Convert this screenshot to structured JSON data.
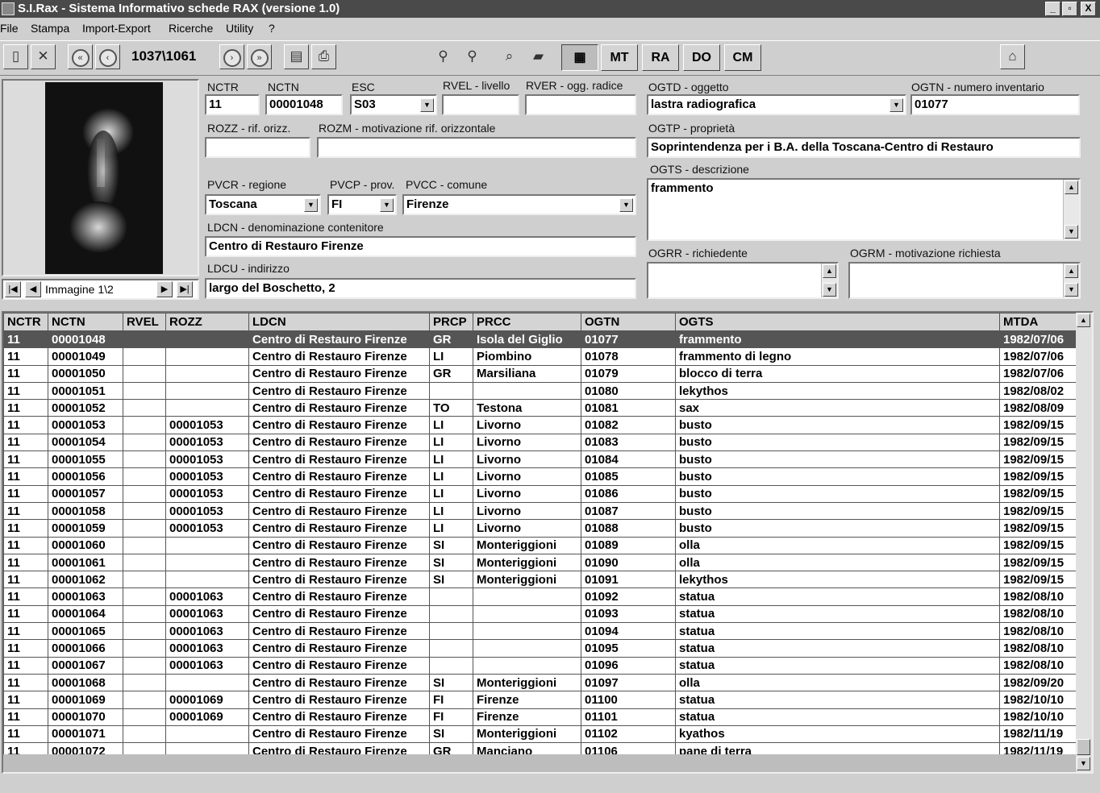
{
  "window": {
    "title": "S.I.Rax - Sistema Informativo schede RAX (versione 1.0)",
    "min": "_",
    "max": "▫",
    "close": "X"
  },
  "menu": [
    "File",
    "Stampa",
    "Import-Export",
    "Ricerche",
    "Utility",
    "?"
  ],
  "toolbar": {
    "counter": "1037\\1061",
    "mt": "MT",
    "ra": "RA",
    "do": "DO",
    "cm": "CM"
  },
  "fields": {
    "nctr": {
      "label": "NCTR",
      "value": "11"
    },
    "nctn": {
      "label": "NCTN",
      "value": "00001048"
    },
    "esc": {
      "label": "ESC",
      "value": "S03"
    },
    "rvel": {
      "label": "RVEL - livello",
      "value": ""
    },
    "rver": {
      "label": "RVER - ogg. radice",
      "value": ""
    },
    "ogtd": {
      "label": "OGTD - oggetto",
      "value": "lastra radiografica"
    },
    "ogtn": {
      "label": "OGTN - numero inventario",
      "value": "01077"
    },
    "rozz": {
      "label": "ROZZ - rif. orizz.",
      "value": ""
    },
    "rozm": {
      "label": "ROZM - motivazione rif. orizzontale",
      "value": ""
    },
    "ogtp": {
      "label": "OGTP - proprietà",
      "value": "Soprintendenza per i B.A. della Toscana-Centro di Restauro"
    },
    "ogts": {
      "label": "OGTS - descrizione",
      "value": "frammento"
    },
    "pvcr": {
      "label": "PVCR - regione",
      "value": "Toscana"
    },
    "pvcp": {
      "label": "PVCP - prov.",
      "value": "FI"
    },
    "pvcc": {
      "label": "PVCC - comune",
      "value": "Firenze"
    },
    "ldcn": {
      "label": "LDCN - denominazione contenitore",
      "value": "Centro di Restauro Firenze"
    },
    "ldcu": {
      "label": "LDCU - indirizzo",
      "value": "largo del Boschetto, 2"
    },
    "ogrr": {
      "label": "OGRR - richiedente",
      "value": ""
    },
    "ogrm": {
      "label": "OGRM - motivazione richiesta",
      "value": ""
    }
  },
  "image_nav": {
    "label": "Immagine 1\\2"
  },
  "table": {
    "columns": [
      "NCTR",
      "NCTN",
      "RVEL",
      "ROZZ",
      "LDCN",
      "PRCP",
      "PRCC",
      "OGTN",
      "OGTS",
      "MTDA"
    ],
    "rows": [
      [
        "11",
        "00001048",
        "",
        "",
        "Centro di Restauro Firenze",
        "GR",
        "Isola del Giglio",
        "01077",
        "frammento",
        "1982/07/06"
      ],
      [
        "11",
        "00001049",
        "",
        "",
        "Centro di Restauro Firenze",
        "LI",
        "Piombino",
        "01078",
        "frammento di legno",
        "1982/07/06"
      ],
      [
        "11",
        "00001050",
        "",
        "",
        "Centro di Restauro Firenze",
        "GR",
        "Marsiliana",
        "01079",
        "blocco di terra",
        "1982/07/06"
      ],
      [
        "11",
        "00001051",
        "",
        "",
        "Centro di Restauro Firenze",
        "",
        "",
        "01080",
        "lekythos",
        "1982/08/02"
      ],
      [
        "11",
        "00001052",
        "",
        "",
        "Centro di Restauro Firenze",
        "TO",
        "Testona",
        "01081",
        "sax",
        "1982/08/09"
      ],
      [
        "11",
        "00001053",
        "",
        "00001053",
        "Centro di Restauro Firenze",
        "LI",
        "Livorno",
        "01082",
        "busto",
        "1982/09/15"
      ],
      [
        "11",
        "00001054",
        "",
        "00001053",
        "Centro di Restauro Firenze",
        "LI",
        "Livorno",
        "01083",
        "busto",
        "1982/09/15"
      ],
      [
        "11",
        "00001055",
        "",
        "00001053",
        "Centro di Restauro Firenze",
        "LI",
        "Livorno",
        "01084",
        "busto",
        "1982/09/15"
      ],
      [
        "11",
        "00001056",
        "",
        "00001053",
        "Centro di Restauro Firenze",
        "LI",
        "Livorno",
        "01085",
        "busto",
        "1982/09/15"
      ],
      [
        "11",
        "00001057",
        "",
        "00001053",
        "Centro di Restauro Firenze",
        "LI",
        "Livorno",
        "01086",
        "busto",
        "1982/09/15"
      ],
      [
        "11",
        "00001058",
        "",
        "00001053",
        "Centro di Restauro Firenze",
        "LI",
        "Livorno",
        "01087",
        "busto",
        "1982/09/15"
      ],
      [
        "11",
        "00001059",
        "",
        "00001053",
        "Centro di Restauro Firenze",
        "LI",
        "Livorno",
        "01088",
        "busto",
        "1982/09/15"
      ],
      [
        "11",
        "00001060",
        "",
        "",
        "Centro di Restauro Firenze",
        "SI",
        "Monteriggioni",
        "01089",
        "olla",
        "1982/09/15"
      ],
      [
        "11",
        "00001061",
        "",
        "",
        "Centro di Restauro Firenze",
        "SI",
        "Monteriggioni",
        "01090",
        "olla",
        "1982/09/15"
      ],
      [
        "11",
        "00001062",
        "",
        "",
        "Centro di Restauro Firenze",
        "SI",
        "Monteriggioni",
        "01091",
        "lekythos",
        "1982/09/15"
      ],
      [
        "11",
        "00001063",
        "",
        "00001063",
        "Centro di Restauro Firenze",
        "",
        "",
        "01092",
        "statua",
        "1982/08/10"
      ],
      [
        "11",
        "00001064",
        "",
        "00001063",
        "Centro di Restauro Firenze",
        "",
        "",
        "01093",
        "statua",
        "1982/08/10"
      ],
      [
        "11",
        "00001065",
        "",
        "00001063",
        "Centro di Restauro Firenze",
        "",
        "",
        "01094",
        "statua",
        "1982/08/10"
      ],
      [
        "11",
        "00001066",
        "",
        "00001063",
        "Centro di Restauro Firenze",
        "",
        "",
        "01095",
        "statua",
        "1982/08/10"
      ],
      [
        "11",
        "00001067",
        "",
        "00001063",
        "Centro di Restauro Firenze",
        "",
        "",
        "01096",
        "statua",
        "1982/08/10"
      ],
      [
        "11",
        "00001068",
        "",
        "",
        "Centro di Restauro Firenze",
        "SI",
        "Monteriggioni",
        "01097",
        "olla",
        "1982/09/20"
      ],
      [
        "11",
        "00001069",
        "",
        "00001069",
        "Centro di Restauro Firenze",
        "FI",
        "Firenze",
        "01100",
        "statua",
        "1982/10/10"
      ],
      [
        "11",
        "00001070",
        "",
        "00001069",
        "Centro di Restauro Firenze",
        "FI",
        "Firenze",
        "01101",
        "statua",
        "1982/10/10"
      ],
      [
        "11",
        "00001071",
        "",
        "",
        "Centro di Restauro Firenze",
        "SI",
        "Monteriggioni",
        "01102",
        "kyathos",
        "1982/11/19"
      ],
      [
        "11",
        "00001072",
        "",
        "",
        "Centro di Restauro Firenze",
        "GR",
        "Manciano",
        "01106",
        "pane di terra",
        "1982/11/19"
      ]
    ]
  }
}
